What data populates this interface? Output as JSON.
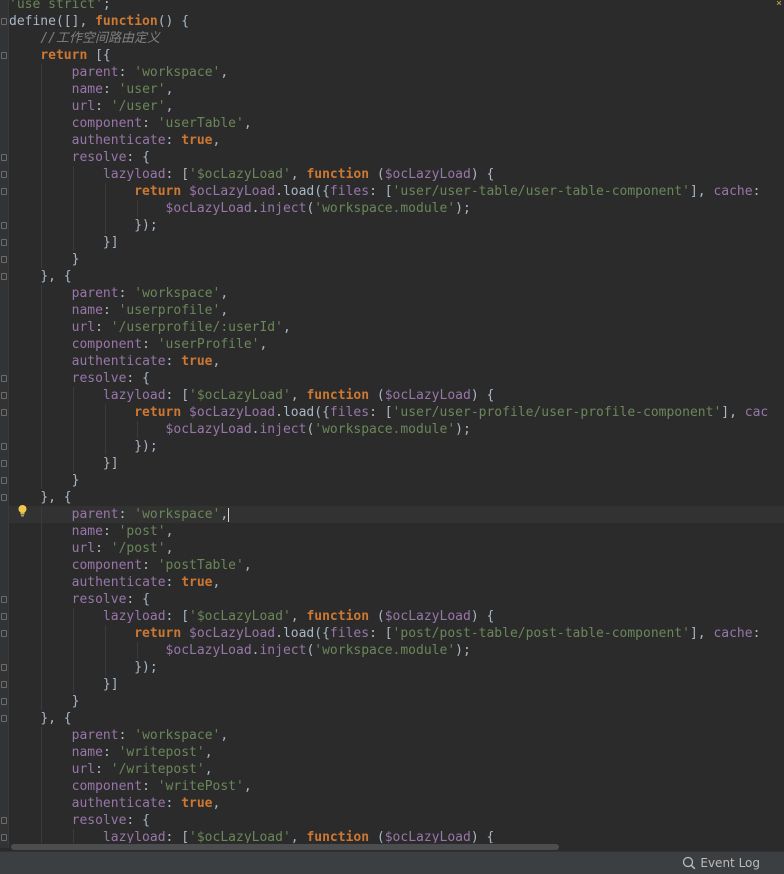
{
  "editor": {
    "lines": [
      {
        "indent": 0,
        "tokens": [
          [
            "str",
            "'use strict'"
          ],
          [
            "plain",
            ";"
          ]
        ]
      },
      {
        "indent": 0,
        "tokens": [
          [
            "plain",
            "define([], "
          ],
          [
            "kw",
            "function"
          ],
          [
            "plain",
            "() {"
          ]
        ]
      },
      {
        "indent": 1,
        "tokens": [
          [
            "com",
            "//工作空间路由定义"
          ]
        ]
      },
      {
        "indent": 1,
        "tokens": [
          [
            "kw",
            "return"
          ],
          [
            "plain",
            " [{"
          ]
        ]
      },
      {
        "indent": 2,
        "tokens": [
          [
            "prop",
            "parent"
          ],
          [
            "plain",
            ": "
          ],
          [
            "str",
            "'workspace'"
          ],
          [
            "plain",
            ","
          ]
        ]
      },
      {
        "indent": 2,
        "tokens": [
          [
            "prop",
            "name"
          ],
          [
            "plain",
            ": "
          ],
          [
            "str",
            "'user'"
          ],
          [
            "plain",
            ","
          ]
        ]
      },
      {
        "indent": 2,
        "tokens": [
          [
            "prop",
            "url"
          ],
          [
            "plain",
            ": "
          ],
          [
            "str",
            "'/user'"
          ],
          [
            "plain",
            ","
          ]
        ]
      },
      {
        "indent": 2,
        "tokens": [
          [
            "prop",
            "component"
          ],
          [
            "plain",
            ": "
          ],
          [
            "str",
            "'userTable'"
          ],
          [
            "plain",
            ","
          ]
        ]
      },
      {
        "indent": 2,
        "tokens": [
          [
            "prop",
            "authenticate"
          ],
          [
            "plain",
            ": "
          ],
          [
            "kw",
            "true"
          ],
          [
            "plain",
            ","
          ]
        ]
      },
      {
        "indent": 2,
        "tokens": [
          [
            "prop",
            "resolve"
          ],
          [
            "plain",
            ": {"
          ]
        ]
      },
      {
        "indent": 3,
        "tokens": [
          [
            "prop",
            "lazyload"
          ],
          [
            "plain",
            ": ["
          ],
          [
            "str",
            "'$ocLazyLoad'"
          ],
          [
            "plain",
            ", "
          ],
          [
            "kw",
            "function"
          ],
          [
            "plain",
            " ("
          ],
          [
            "prop",
            "$ocLazyLoad"
          ],
          [
            "plain",
            ") {"
          ]
        ]
      },
      {
        "indent": 4,
        "tokens": [
          [
            "kw",
            "return"
          ],
          [
            "plain",
            " "
          ],
          [
            "prop",
            "$ocLazyLoad"
          ],
          [
            "plain",
            ".load({"
          ],
          [
            "prop",
            "files"
          ],
          [
            "plain",
            ": ["
          ],
          [
            "str",
            "'user/user-table/user-table-component'"
          ],
          [
            "plain",
            "], "
          ],
          [
            "prop",
            "cache"
          ],
          [
            "plain",
            ": "
          ]
        ]
      },
      {
        "indent": 5,
        "tokens": [
          [
            "prop",
            "$ocLazyLoad"
          ],
          [
            "plain",
            "."
          ],
          [
            "prop",
            "inject"
          ],
          [
            "plain",
            "("
          ],
          [
            "str",
            "'workspace.module'"
          ],
          [
            "plain",
            ");"
          ]
        ]
      },
      {
        "indent": 4,
        "tokens": [
          [
            "plain",
            "});"
          ]
        ]
      },
      {
        "indent": 3,
        "tokens": [
          [
            "plain",
            "}]"
          ]
        ]
      },
      {
        "indent": 2,
        "tokens": [
          [
            "plain",
            "}"
          ]
        ]
      },
      {
        "indent": 1,
        "tokens": [
          [
            "plain",
            "}, {"
          ]
        ]
      },
      {
        "indent": 2,
        "tokens": [
          [
            "prop",
            "parent"
          ],
          [
            "plain",
            ": "
          ],
          [
            "str",
            "'workspace'"
          ],
          [
            "plain",
            ","
          ]
        ]
      },
      {
        "indent": 2,
        "tokens": [
          [
            "prop",
            "name"
          ],
          [
            "plain",
            ": "
          ],
          [
            "str",
            "'userprofile'"
          ],
          [
            "plain",
            ","
          ]
        ]
      },
      {
        "indent": 2,
        "tokens": [
          [
            "prop",
            "url"
          ],
          [
            "plain",
            ": "
          ],
          [
            "str",
            "'/userprofile/:userId'"
          ],
          [
            "plain",
            ","
          ]
        ]
      },
      {
        "indent": 2,
        "tokens": [
          [
            "prop",
            "component"
          ],
          [
            "plain",
            ": "
          ],
          [
            "str",
            "'userProfile'"
          ],
          [
            "plain",
            ","
          ]
        ]
      },
      {
        "indent": 2,
        "tokens": [
          [
            "prop",
            "authenticate"
          ],
          [
            "plain",
            ": "
          ],
          [
            "kw",
            "true"
          ],
          [
            "plain",
            ","
          ]
        ]
      },
      {
        "indent": 2,
        "tokens": [
          [
            "prop",
            "resolve"
          ],
          [
            "plain",
            ": {"
          ]
        ]
      },
      {
        "indent": 3,
        "tokens": [
          [
            "prop",
            "lazyload"
          ],
          [
            "plain",
            ": ["
          ],
          [
            "str",
            "'$ocLazyLoad'"
          ],
          [
            "plain",
            ", "
          ],
          [
            "kw",
            "function"
          ],
          [
            "plain",
            " ("
          ],
          [
            "prop",
            "$ocLazyLoad"
          ],
          [
            "plain",
            ") {"
          ]
        ]
      },
      {
        "indent": 4,
        "tokens": [
          [
            "kw",
            "return"
          ],
          [
            "plain",
            " "
          ],
          [
            "prop",
            "$ocLazyLoad"
          ],
          [
            "plain",
            ".load({"
          ],
          [
            "prop",
            "files"
          ],
          [
            "plain",
            ": ["
          ],
          [
            "str",
            "'user/user-profile/user-profile-component'"
          ],
          [
            "plain",
            "], "
          ],
          [
            "prop",
            "cac"
          ]
        ]
      },
      {
        "indent": 5,
        "tokens": [
          [
            "prop",
            "$ocLazyLoad"
          ],
          [
            "plain",
            "."
          ],
          [
            "prop",
            "inject"
          ],
          [
            "plain",
            "("
          ],
          [
            "str",
            "'workspace.module'"
          ],
          [
            "plain",
            ");"
          ]
        ]
      },
      {
        "indent": 4,
        "tokens": [
          [
            "plain",
            "});"
          ]
        ]
      },
      {
        "indent": 3,
        "tokens": [
          [
            "plain",
            "}]"
          ]
        ]
      },
      {
        "indent": 2,
        "tokens": [
          [
            "plain",
            "}"
          ]
        ]
      },
      {
        "indent": 1,
        "tokens": [
          [
            "plain",
            "}, {"
          ]
        ]
      },
      {
        "indent": 2,
        "current": true,
        "tokens": [
          [
            "prop",
            "parent"
          ],
          [
            "plain",
            ": "
          ],
          [
            "str",
            "'workspace'"
          ],
          [
            "plain",
            ","
          ]
        ]
      },
      {
        "indent": 2,
        "tokens": [
          [
            "prop",
            "name"
          ],
          [
            "plain",
            ": "
          ],
          [
            "str",
            "'post'"
          ],
          [
            "plain",
            ","
          ]
        ]
      },
      {
        "indent": 2,
        "tokens": [
          [
            "prop",
            "url"
          ],
          [
            "plain",
            ": "
          ],
          [
            "str",
            "'/post'"
          ],
          [
            "plain",
            ","
          ]
        ]
      },
      {
        "indent": 2,
        "tokens": [
          [
            "prop",
            "component"
          ],
          [
            "plain",
            ": "
          ],
          [
            "str",
            "'postTable'"
          ],
          [
            "plain",
            ","
          ]
        ]
      },
      {
        "indent": 2,
        "tokens": [
          [
            "prop",
            "authenticate"
          ],
          [
            "plain",
            ": "
          ],
          [
            "kw",
            "true"
          ],
          [
            "plain",
            ","
          ]
        ]
      },
      {
        "indent": 2,
        "tokens": [
          [
            "prop",
            "resolve"
          ],
          [
            "plain",
            ": {"
          ]
        ]
      },
      {
        "indent": 3,
        "tokens": [
          [
            "prop",
            "lazyload"
          ],
          [
            "plain",
            ": ["
          ],
          [
            "str",
            "'$ocLazyLoad'"
          ],
          [
            "plain",
            ", "
          ],
          [
            "kw",
            "function"
          ],
          [
            "plain",
            " ("
          ],
          [
            "prop",
            "$ocLazyLoad"
          ],
          [
            "plain",
            ") {"
          ]
        ]
      },
      {
        "indent": 4,
        "tokens": [
          [
            "kw",
            "return"
          ],
          [
            "plain",
            " "
          ],
          [
            "prop",
            "$ocLazyLoad"
          ],
          [
            "plain",
            ".load({"
          ],
          [
            "prop",
            "files"
          ],
          [
            "plain",
            ": ["
          ],
          [
            "str",
            "'post/post-table/post-table-component'"
          ],
          [
            "plain",
            "], "
          ],
          [
            "prop",
            "cache"
          ],
          [
            "plain",
            ": "
          ]
        ]
      },
      {
        "indent": 5,
        "tokens": [
          [
            "prop",
            "$ocLazyLoad"
          ],
          [
            "plain",
            "."
          ],
          [
            "prop",
            "inject"
          ],
          [
            "plain",
            "("
          ],
          [
            "str",
            "'workspace.module'"
          ],
          [
            "plain",
            ");"
          ]
        ]
      },
      {
        "indent": 4,
        "tokens": [
          [
            "plain",
            "});"
          ]
        ]
      },
      {
        "indent": 3,
        "tokens": [
          [
            "plain",
            "}]"
          ]
        ]
      },
      {
        "indent": 2,
        "tokens": [
          [
            "plain",
            "}"
          ]
        ]
      },
      {
        "indent": 1,
        "tokens": [
          [
            "plain",
            "}, {"
          ]
        ]
      },
      {
        "indent": 2,
        "tokens": [
          [
            "prop",
            "parent"
          ],
          [
            "plain",
            ": "
          ],
          [
            "str",
            "'workspace'"
          ],
          [
            "plain",
            ","
          ]
        ]
      },
      {
        "indent": 2,
        "tokens": [
          [
            "prop",
            "name"
          ],
          [
            "plain",
            ": "
          ],
          [
            "str",
            "'writepost'"
          ],
          [
            "plain",
            ","
          ]
        ]
      },
      {
        "indent": 2,
        "tokens": [
          [
            "prop",
            "url"
          ],
          [
            "plain",
            ": "
          ],
          [
            "str",
            "'/writepost'"
          ],
          [
            "plain",
            ","
          ]
        ]
      },
      {
        "indent": 2,
        "tokens": [
          [
            "prop",
            "component"
          ],
          [
            "plain",
            ": "
          ],
          [
            "str",
            "'writePost'"
          ],
          [
            "plain",
            ","
          ]
        ]
      },
      {
        "indent": 2,
        "tokens": [
          [
            "prop",
            "authenticate"
          ],
          [
            "plain",
            ": "
          ],
          [
            "kw",
            "true"
          ],
          [
            "plain",
            ","
          ]
        ]
      },
      {
        "indent": 2,
        "tokens": [
          [
            "prop",
            "resolve"
          ],
          [
            "plain",
            ": {"
          ]
        ]
      },
      {
        "indent": 3,
        "tokens": [
          [
            "prop",
            "lazyload"
          ],
          [
            "plain",
            ": ["
          ],
          [
            "str",
            "'$ocLazyLoad'"
          ],
          [
            "plain",
            ", "
          ],
          [
            "kw",
            "function"
          ],
          [
            "plain",
            " ("
          ],
          [
            "prop",
            "$ocLazyLoad"
          ],
          [
            "plain",
            ") {"
          ]
        ]
      }
    ]
  },
  "gutter": {
    "fold_marker_lines": [
      1,
      3,
      9,
      10,
      11,
      13,
      14,
      15,
      16,
      22,
      23,
      24,
      26,
      27,
      28,
      29,
      35,
      36,
      37,
      39,
      40,
      41,
      42,
      48,
      49
    ],
    "intention_icon": "lightbulb-icon"
  },
  "status_bar": {
    "event_log_label": "Event Log",
    "event_log_icon": "search-icon"
  },
  "colors": {
    "background": "#2b2b2b",
    "keyword": "#cc7832",
    "string": "#6a8759",
    "property": "#9876aa",
    "comment": "#808080",
    "text": "#a9b7c6"
  }
}
